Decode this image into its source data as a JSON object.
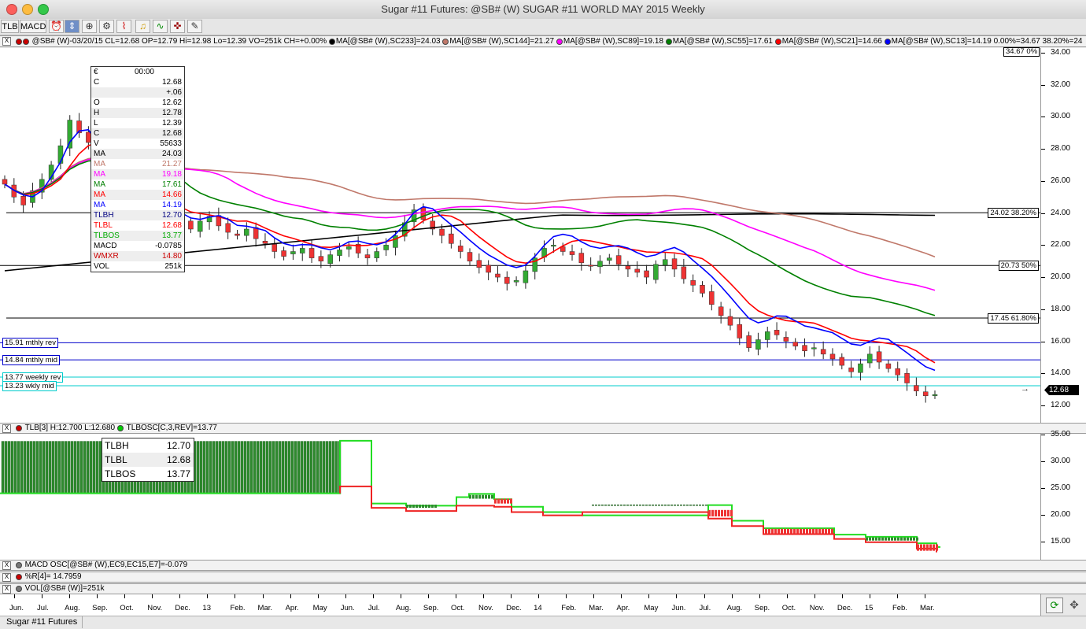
{
  "window": {
    "title": "Sugar #11 Futures: @SB# (W) SUGAR #11 WORLD MAY 2015 Weekly",
    "traffic_colors": [
      "#fc605c",
      "#fdbc40",
      "#34c84a"
    ]
  },
  "toolbar": {
    "tlb_label": "TLB",
    "macd_label": "MACD",
    "icons": [
      "clock-icon",
      "cursor-icon",
      "zoom-icon",
      "gear-icon",
      "chart-icon",
      "bell-icon",
      "line-chart-icon",
      "pin-icon",
      "text-edit-icon"
    ]
  },
  "price_header": {
    "close_box": "X",
    "text": "@SB# (W)-03/20/15 CL=12.68 OP=12.79 Hi=12.98 Lo=12.39 VO=251k CH=+0.00%",
    "studies": [
      {
        "text": "MA[@SB# (W),SC233]=24.03",
        "color": "#000000"
      },
      {
        "text": "MA[@SB# (W),SC144]=21.27",
        "color": "#c0786a"
      },
      {
        "text": "MA[@SB# (W),SC89]=19.18",
        "color": "#ff00ff"
      },
      {
        "text": "MA[@SB# (W),SC55]=17.61",
        "color": "#008000"
      },
      {
        "text": "MA[@SB# (W),SC21]=14.66",
        "color": "#ff0000"
      },
      {
        "text": "MA[@SB# (W),SC13]=14.19",
        "color": "#0000ff"
      }
    ],
    "tail": "0.00%=34.67 38.20%=24"
  },
  "price_axis": {
    "ticks": [
      "34.00",
      "32.00",
      "30.00",
      "28.00",
      "26.00",
      "24.00",
      "22.00",
      "20.00",
      "18.00",
      "16.00",
      "14.00",
      "12.00"
    ],
    "top_label": "34.67 0%",
    "last_price": "12.68",
    "arrow": "→"
  },
  "levels": [
    {
      "label": "24.02 38.20%",
      "value": 24.02,
      "color": "#000000"
    },
    {
      "label": "20.73 50%",
      "value": 20.73,
      "color": "#000000"
    },
    {
      "label": "17.45 61.80%",
      "value": 17.45,
      "color": "#000000"
    }
  ],
  "reversal_lines": [
    {
      "label": "15.91 mthly rev",
      "value": 15.91,
      "color": "#0000cc"
    },
    {
      "label": "14.84 mthly mid",
      "value": 14.84,
      "color": "#0000cc"
    },
    {
      "label": "13.77 weekly rev",
      "value": 13.77,
      "color": "#00cccc"
    },
    {
      "label": "13.23 wkly mid",
      "value": 13.23,
      "color": "#00cccc"
    }
  ],
  "data_window": {
    "header_key": "€",
    "header_value": "00:00",
    "rows": [
      {
        "k": "C",
        "v": "12.68",
        "color": "#000000"
      },
      {
        "k": "",
        "v": "+.06",
        "color": "#000000"
      },
      {
        "k": "O",
        "v": "12.62",
        "color": "#000000"
      },
      {
        "k": "H",
        "v": "12.78",
        "color": "#000000"
      },
      {
        "k": "L",
        "v": "12.39",
        "color": "#000000"
      },
      {
        "k": "C",
        "v": "12.68",
        "color": "#000000"
      },
      {
        "k": "V",
        "v": "55633",
        "color": "#000000"
      },
      {
        "k": "MA",
        "v": "24.03",
        "color": "#000000"
      },
      {
        "k": "MA",
        "v": "21.27",
        "color": "#c0786a"
      },
      {
        "k": "MA",
        "v": "19.18",
        "color": "#ff00ff"
      },
      {
        "k": "MA",
        "v": "17.61",
        "color": "#008000"
      },
      {
        "k": "MA",
        "v": "14.66",
        "color": "#ff0000"
      },
      {
        "k": "MA",
        "v": "14.19",
        "color": "#0000ff"
      },
      {
        "k": "TLBH",
        "v": "12.70",
        "color": "#000080"
      },
      {
        "k": "TLBL",
        "v": "12.68",
        "color": "#ff0000"
      },
      {
        "k": "TLBOS",
        "v": "13.77",
        "color": "#00aa00"
      },
      {
        "k": "MACD",
        "v": "-0.0785",
        "color": "#000000"
      },
      {
        "k": "WMXR",
        "v": "14.80",
        "color": "#cc0000"
      },
      {
        "k": "VOL",
        "v": "251k",
        "color": "#000000"
      }
    ]
  },
  "tlb_header": {
    "text": "TLB[3] H:12.700 L:12.680",
    "study": "TLBOSC[C,3,REV]=13.77"
  },
  "tlb_box": [
    {
      "k": "TLBH",
      "v": "12.70"
    },
    {
      "k": "TLBL",
      "v": "12.68"
    },
    {
      "k": "TLBOS",
      "v": "13.77"
    }
  ],
  "tlb_axis": {
    "ticks": [
      "35.00",
      "30.00",
      "25.00",
      "20.00",
      "15.00"
    ]
  },
  "macd_header": "MACD OSC[@SB# (W),EC9,EC15,E7]=-0.079",
  "wr_header": "%R[4]= 14.7959",
  "vol_header": "VOL[@SB# (W)]=251k",
  "time_axis": [
    "Jun.",
    "Jul.",
    "Aug.",
    "Sep.",
    "Oct.",
    "Nov.",
    "Dec.",
    "13",
    "Feb.",
    "Mar.",
    "Apr.",
    "May",
    "Jun.",
    "Jul.",
    "Aug.",
    "Sep.",
    "Oct.",
    "Nov.",
    "Dec.",
    "14",
    "Feb.",
    "Mar.",
    "Apr.",
    "May",
    "Jun.",
    "Jul.",
    "Aug.",
    "Sep.",
    "Oct.",
    "Nov.",
    "Dec.",
    "15",
    "Feb.",
    "Mar."
  ],
  "status_tab": "Sugar #11 Futures",
  "chart_data": {
    "type": "candlestick",
    "symbol": "@SB# (W)",
    "ylim": [
      11.5,
      34.0
    ],
    "last": {
      "date": "03/20/15",
      "open": 12.79,
      "high": 12.98,
      "low": 12.39,
      "close": 12.68
    },
    "moving_averages": [
      {
        "name": "MA[@SB# (W),SC233]",
        "last": 24.03,
        "color": "#000000"
      },
      {
        "name": "MA[@SB# (W),SC144]",
        "last": 21.27,
        "color": "#c0786a"
      },
      {
        "name": "MA[@SB# (W),SC89]",
        "last": 19.18,
        "color": "#ff00ff"
      },
      {
        "name": "MA[@SB# (W),SC55]",
        "last": 17.61,
        "color": "#008000"
      },
      {
        "name": "MA[@SB# (W),SC21]",
        "last": 14.66,
        "color": "#ff0000"
      },
      {
        "name": "MA[@SB# (W),SC13]",
        "last": 14.19,
        "color": "#0000ff"
      }
    ],
    "closes": [
      25.8,
      25.0,
      24.5,
      25.4,
      26.1,
      27.0,
      28.2,
      29.8,
      29.0,
      28.4,
      27.2,
      26.0,
      25.0,
      24.6,
      24.8,
      24.2,
      24.4,
      24.0,
      23.8,
      23.4,
      23.0,
      23.5,
      23.8,
      23.2,
      22.8,
      22.6,
      23.0,
      22.4,
      22.1,
      21.6,
      21.3,
      21.6,
      21.8,
      21.2,
      21.0,
      21.4,
      21.7,
      21.9,
      21.5,
      21.2,
      21.6,
      22.0,
      22.6,
      23.4,
      24.2,
      23.6,
      23.0,
      22.6,
      22.1,
      21.6,
      21.0,
      20.6,
      20.3,
      20.0,
      19.6,
      19.8,
      20.4,
      21.2,
      21.8,
      22.0,
      21.6,
      21.4,
      20.9,
      20.7,
      21.0,
      21.2,
      20.8,
      20.5,
      20.3,
      20.0,
      20.8,
      21.1,
      20.5,
      19.9,
      19.5,
      19.0,
      18.3,
      17.6,
      17.0,
      16.2,
      15.6,
      16.1,
      16.6,
      16.4,
      16.0,
      15.7,
      15.4,
      15.6,
      15.2,
      14.9,
      14.5,
      14.1,
      14.6,
      15.2,
      14.7,
      14.3,
      13.9,
      13.4,
      12.9,
      12.6,
      12.68
    ],
    "tlb_bars_last": {
      "TLBH": 12.7,
      "TLBL": 12.68,
      "TLBOS": 13.77
    }
  }
}
